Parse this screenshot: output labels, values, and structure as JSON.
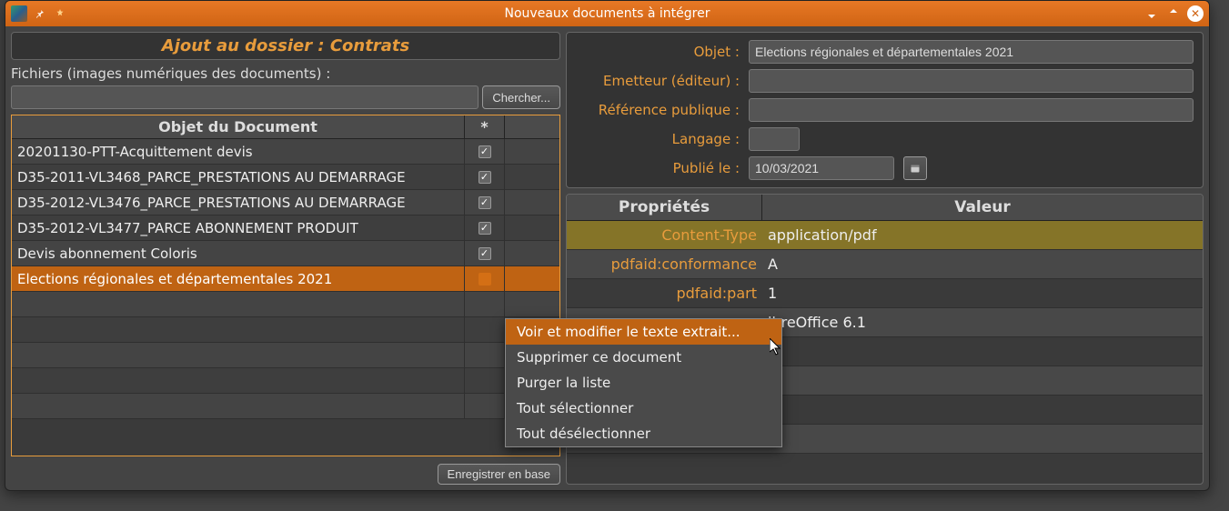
{
  "titlebar": {
    "title": "Nouveaux documents à intégrer"
  },
  "left": {
    "header": "Ajout au dossier : Contrats",
    "files_label": "Fichiers (images numériques des documents) :",
    "browse_label": "Chercher...",
    "col_object": "Objet du Document",
    "col_star": "*",
    "rows": [
      {
        "obj": "20201130-PTT-Acquittement devis",
        "checked": true
      },
      {
        "obj": "D35-2011-VL3468_PARCE_PRESTATIONS AU DEMARRAGE",
        "checked": true
      },
      {
        "obj": "D35-2012-VL3476_PARCE_PRESTATIONS AU DEMARRAGE",
        "checked": true
      },
      {
        "obj": "D35-2012-VL3477_PARCE ABONNEMENT PRODUIT",
        "checked": true
      },
      {
        "obj": "Devis abonnement Coloris",
        "checked": true
      },
      {
        "obj": "Elections régionales et départementales 2021",
        "checked": false,
        "selected": true
      }
    ],
    "save_label": "Enregistrer en base"
  },
  "form": {
    "labels": {
      "objet": "Objet :",
      "emetteur": "Emetteur (éditeur) :",
      "reference": "Référence publique :",
      "langage": "Langage :",
      "publie": "Publié le :"
    },
    "values": {
      "objet": "Elections régionales et départementales 2021",
      "emetteur": "",
      "reference": "",
      "langage": "",
      "publie": "10/03/2021"
    }
  },
  "properties": {
    "col_key": "Propriétés",
    "col_val": "Valeur",
    "rows": [
      {
        "k": "Content-Type",
        "v": "application/pdf",
        "selected": true
      },
      {
        "k": "pdfaid:conformance",
        "v": "A"
      },
      {
        "k": "pdfaid:part",
        "v": "1"
      },
      {
        "k": "",
        "v": "ibreOffice 6.1"
      }
    ]
  },
  "context_menu": {
    "items": [
      "Voir et modifier le texte extrait...",
      "Supprimer ce document",
      "Purger la liste",
      "Tout sélectionner",
      "Tout désélectionner"
    ]
  }
}
